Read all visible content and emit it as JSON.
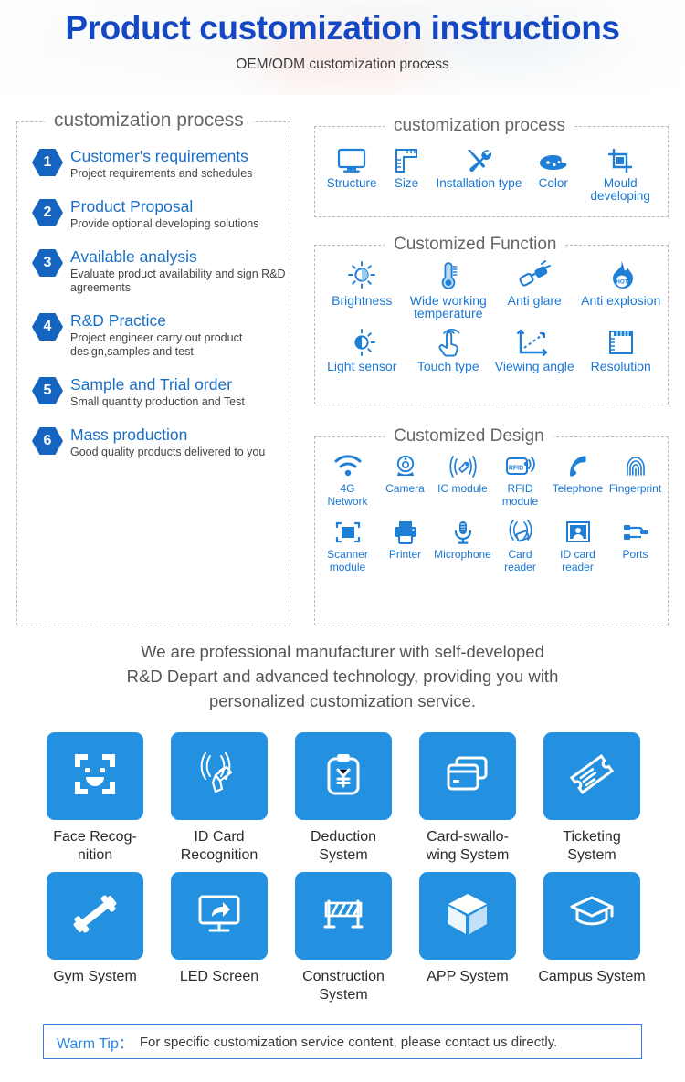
{
  "header": {
    "title": "Product customization instructions",
    "subtitle": "OEM/ODM customization process",
    "title_color": "#1447c4"
  },
  "process_box": {
    "legend": "customization process",
    "steps": [
      {
        "num": "1",
        "title": "Customer's requirements",
        "desc": "Project requirements and schedules"
      },
      {
        "num": "2",
        "title": "Product Proposal",
        "desc": "Provide optional developing solutions"
      },
      {
        "num": "3",
        "title": "Available analysis",
        "desc": "Evaluate product availability and sign R&D agreements"
      },
      {
        "num": "4",
        "title": "R&D Practice",
        "desc": "Project engineer carry out product design,samples and test"
      },
      {
        "num": "5",
        "title": "Sample and Trial order",
        "desc": "Small quantity production and Test"
      },
      {
        "num": "6",
        "title": "Mass production",
        "desc": "Good quality products delivered to you"
      }
    ]
  },
  "customization_box": {
    "legend": "customization process",
    "items": [
      {
        "icon": "monitor-icon",
        "label": "Structure"
      },
      {
        "icon": "ruler-icon",
        "label": "Size"
      },
      {
        "icon": "tools-icon",
        "label": "Installation type"
      },
      {
        "icon": "palette-icon",
        "label": "Color"
      },
      {
        "icon": "crop-mould-icon",
        "label": "Mould developing"
      }
    ]
  },
  "function_box": {
    "legend": "Customized Function",
    "row1": [
      {
        "icon": "brightness-sun-icon",
        "label": "Brightness"
      },
      {
        "icon": "thermometer-icon",
        "label": "Wide working temperature"
      },
      {
        "icon": "anti-glare-sunglasses-icon",
        "label": "Anti glare"
      },
      {
        "icon": "flame-hot-icon",
        "label": "Anti explosion"
      }
    ],
    "row2": [
      {
        "icon": "light-sensor-icon",
        "label": "Light sensor"
      },
      {
        "icon": "touch-hand-icon",
        "label": "Touch type"
      },
      {
        "icon": "viewing-angle-icon",
        "label": "Viewing angle"
      },
      {
        "icon": "resolution-grid-icon",
        "label": "Resolution"
      }
    ]
  },
  "design_box": {
    "legend": "Customized Design",
    "row1": [
      {
        "icon": "wifi-icon",
        "label": "4G Network"
      },
      {
        "icon": "camera-icon",
        "label": "Camera"
      },
      {
        "icon": "ic-module-icon",
        "label": "IC module"
      },
      {
        "icon": "rfid-module-icon",
        "label": "RFID module"
      },
      {
        "icon": "telephone-icon",
        "label": "Telephone"
      },
      {
        "icon": "fingerprint-icon",
        "label": "Fingerprint"
      }
    ],
    "row2": [
      {
        "icon": "scanner-module-icon",
        "label": "Scanner module"
      },
      {
        "icon": "printer-icon",
        "label": "Printer"
      },
      {
        "icon": "microphone-icon",
        "label": "Microphone"
      },
      {
        "icon": "card-reader-icon",
        "label": "Card reader"
      },
      {
        "icon": "id-card-reader-icon",
        "label": "ID card reader"
      },
      {
        "icon": "ports-icon",
        "label": "Ports"
      }
    ]
  },
  "pitch": {
    "line1": "We are professional manufacturer with self-developed",
    "line2": "R&D Depart and advanced technology, providing you with",
    "line3": "personalized customization service."
  },
  "applications": {
    "tile_color": "#2490e0",
    "row1": [
      {
        "icon": "face-recognition-icon",
        "label": "Face Recog-\nnition"
      },
      {
        "icon": "id-card-recognition-icon",
        "label": "ID Card\nRecognition"
      },
      {
        "icon": "deduction-clipboard-icon",
        "label": "Deduction\nSystem"
      },
      {
        "icon": "card-swallowing-icon",
        "label": "Card-swallo-\nwing System"
      },
      {
        "icon": "ticket-icon",
        "label": "Ticketing\nSystem"
      }
    ],
    "row2": [
      {
        "icon": "dumbbell-icon",
        "label": "Gym System"
      },
      {
        "icon": "led-screen-icon",
        "label": "LED Screen"
      },
      {
        "icon": "construction-barrier-icon",
        "label": "Construction\nSystem"
      },
      {
        "icon": "app-cube-icon",
        "label": "APP System"
      },
      {
        "icon": "campus-graduation-icon",
        "label": "Campus System"
      }
    ]
  },
  "warm_tip": {
    "label": "Warm Tip：",
    "text": "For specific customization service content, please contact us directly.",
    "label_color": "#2a86e0",
    "border_color": "#3b7ddd"
  }
}
